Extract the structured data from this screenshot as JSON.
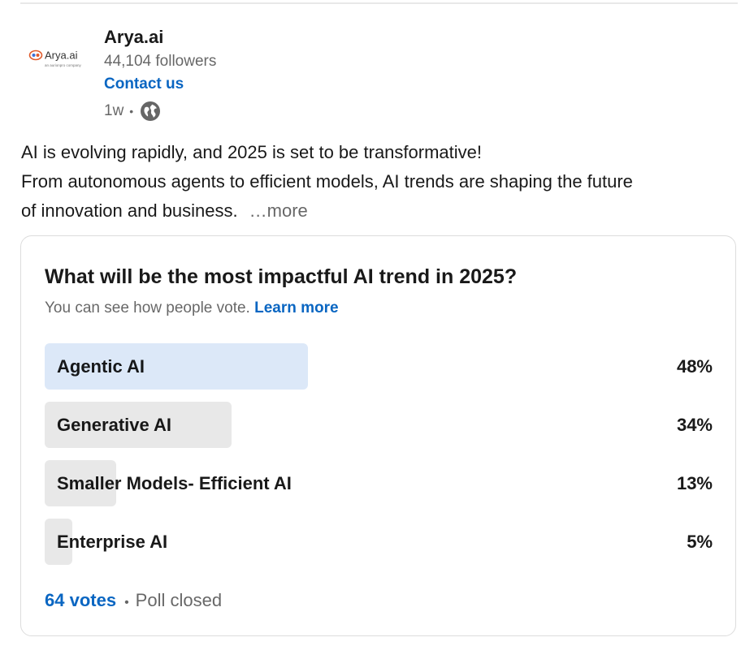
{
  "company": {
    "logo_text": "Arya.ai",
    "logo_subtext": "an aurionpro company",
    "name": "Arya.ai",
    "followers": "44,104 followers",
    "contact_label": "Contact us",
    "time_ago": "1w",
    "visibility_icon": "globe-icon"
  },
  "post": {
    "lines": [
      "AI is evolving rapidly, and 2025 is set to be transformative!",
      "From autonomous agents to efficient models, AI trends are shaping the future",
      "of innovation and business."
    ],
    "more_label": "…more"
  },
  "poll": {
    "question": "What will be the most impactful AI trend in 2025?",
    "note": "You can see how people vote.",
    "learn_more": "Learn more",
    "options": [
      {
        "label": "Agentic AI",
        "percent_text": "48%",
        "percent": 48,
        "selected": true
      },
      {
        "label": "Generative AI",
        "percent_text": "34%",
        "percent": 34,
        "selected": false
      },
      {
        "label": "Smaller Models- Efficient AI",
        "percent_text": "13%",
        "percent": 13,
        "selected": false
      },
      {
        "label": "Enterprise AI",
        "percent_text": "5%",
        "percent": 5,
        "selected": false
      }
    ],
    "votes_label": "64 votes",
    "status": "Poll closed"
  },
  "colors": {
    "link": "#0a66c2",
    "selected_fill": "#dce8f8",
    "option_fill": "#e8e8e8"
  }
}
